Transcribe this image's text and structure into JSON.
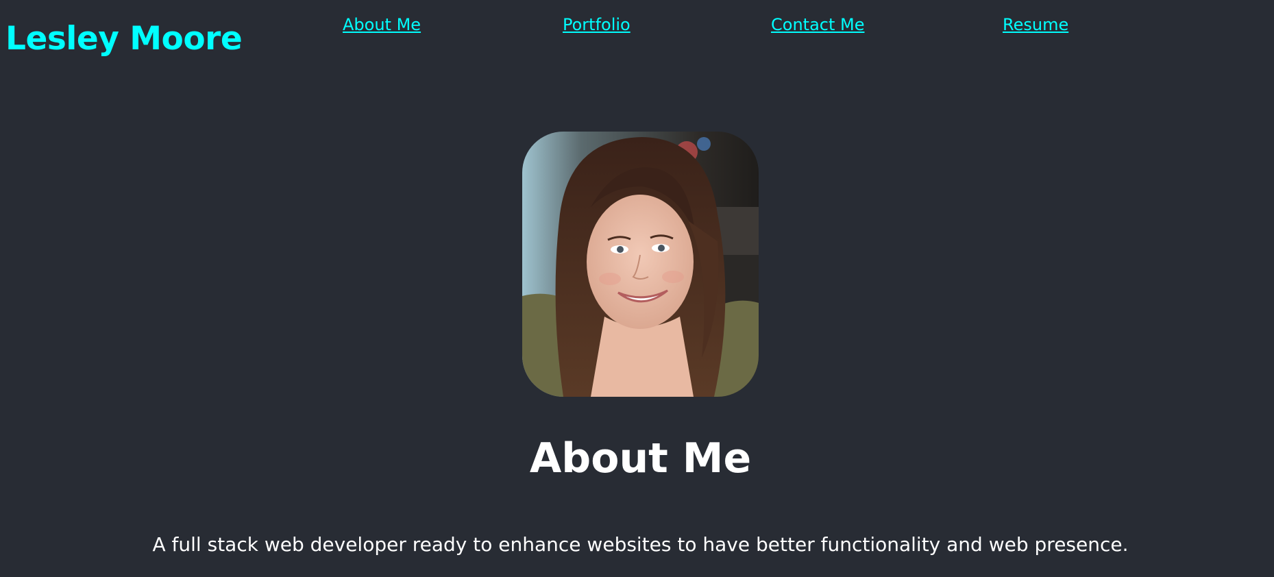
{
  "header": {
    "brand": "Lesley Moore",
    "nav": {
      "about": "About Me",
      "portfolio": "Portfolio",
      "contact": "Contact Me",
      "resume": "Resume"
    }
  },
  "main": {
    "photo": {
      "alt": "Lesley Moore"
    },
    "section_title": "About Me",
    "bio": "A full stack web developer ready to enhance websites to have better functionality and web presence."
  },
  "colors": {
    "background": "#282c34",
    "accent": "#00ffff",
    "text": "#ffffff"
  }
}
